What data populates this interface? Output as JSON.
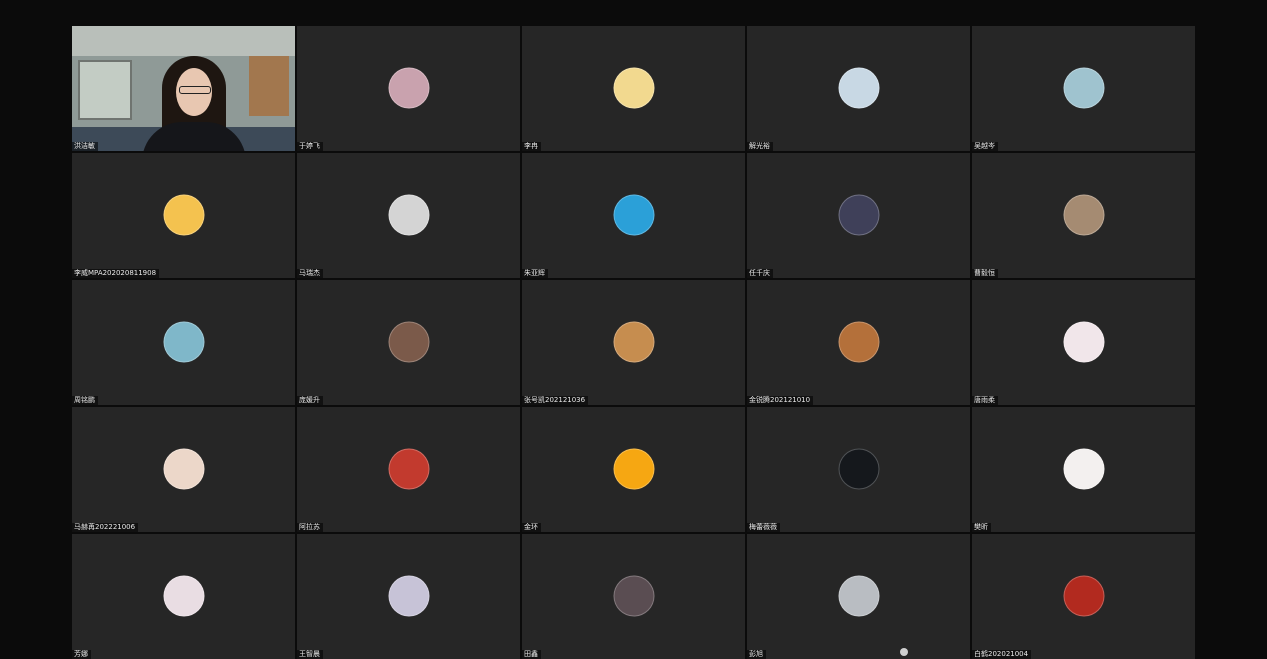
{
  "meeting": {
    "participants": [
      {
        "name": "洪洁敏",
        "video": true,
        "active": true
      },
      {
        "name": "于婷飞",
        "avatar_color": "#c9a2ae",
        "icon": "square-avatar-icon"
      },
      {
        "name": "李冉",
        "avatar_color": "#f2d98f",
        "icon": "cartoon-sponge-avatar-icon"
      },
      {
        "name": "解光裕",
        "avatar_color": "#c8d8e4",
        "icon": "person-silhouette-avatar-icon"
      },
      {
        "name": "吴越岑",
        "avatar_color": "#9fc3cf",
        "icon": "character-avatar-icon"
      },
      {
        "name": "李威MPA202020811908",
        "avatar_color": "#f4c24f",
        "icon": "cartoon-avatar-icon"
      },
      {
        "name": "马瑞杰",
        "avatar_color": "#d4d4d4",
        "icon": "anime-girl-avatar-icon"
      },
      {
        "name": "朱亚辉",
        "avatar_color": "#2ba0d8",
        "icon": "fish-avatar-icon"
      },
      {
        "name": "任千庆",
        "avatar_color": "#3f4059",
        "icon": "photo-avatar-icon"
      },
      {
        "name": "曹毅恒",
        "avatar_color": "#a58b72",
        "icon": "photo-avatar-icon"
      },
      {
        "name": "周铭鹏",
        "avatar_color": "#7fb7c9",
        "icon": "cartoon-girl-avatar-icon"
      },
      {
        "name": "庞媛升",
        "avatar_color": "#7b5a4a",
        "icon": "photo-avatar-icon"
      },
      {
        "name": "张号凯202121036",
        "avatar_color": "#c68d4f",
        "icon": "dog-avatar-icon"
      },
      {
        "name": "金锐腾202121010",
        "avatar_color": "#b4703a",
        "icon": "dog-avatar-icon"
      },
      {
        "name": "唐雨柔",
        "avatar_color": "#f1e6ea",
        "icon": "cartoon-animal-avatar-icon"
      },
      {
        "name": "马赫苒202221006",
        "avatar_color": "#ecd7c9",
        "icon": "cartoon-girl-avatar-icon"
      },
      {
        "name": "阿拉苏",
        "avatar_color": "#c23a2e",
        "icon": "runner-avatar-icon"
      },
      {
        "name": "金环",
        "avatar_color": "#f6a712",
        "icon": "sun-avatar-icon"
      },
      {
        "name": "梅蕾薇薇",
        "avatar_color": "#15181c",
        "icon": "dark-photo-avatar-icon"
      },
      {
        "name": "樊昕",
        "avatar_color": "#f3f0ef",
        "icon": "pig-avatar-icon"
      },
      {
        "name": "芳娜",
        "avatar_color": "#e9dde3",
        "icon": "anime-girl-avatar-icon"
      },
      {
        "name": "王智晨",
        "avatar_color": "#c7c3d7",
        "icon": "anime-girl-avatar-icon"
      },
      {
        "name": "田鑫",
        "avatar_color": "#5a4d52",
        "icon": "building-photo-avatar-icon"
      },
      {
        "name": "彭旭",
        "avatar_color": "#b9bdc2",
        "icon": "person-photo-avatar-icon"
      },
      {
        "name": "白鹤202021004",
        "avatar_color": "#b22a1f",
        "icon": "group-photo-avatar-icon"
      }
    ]
  }
}
